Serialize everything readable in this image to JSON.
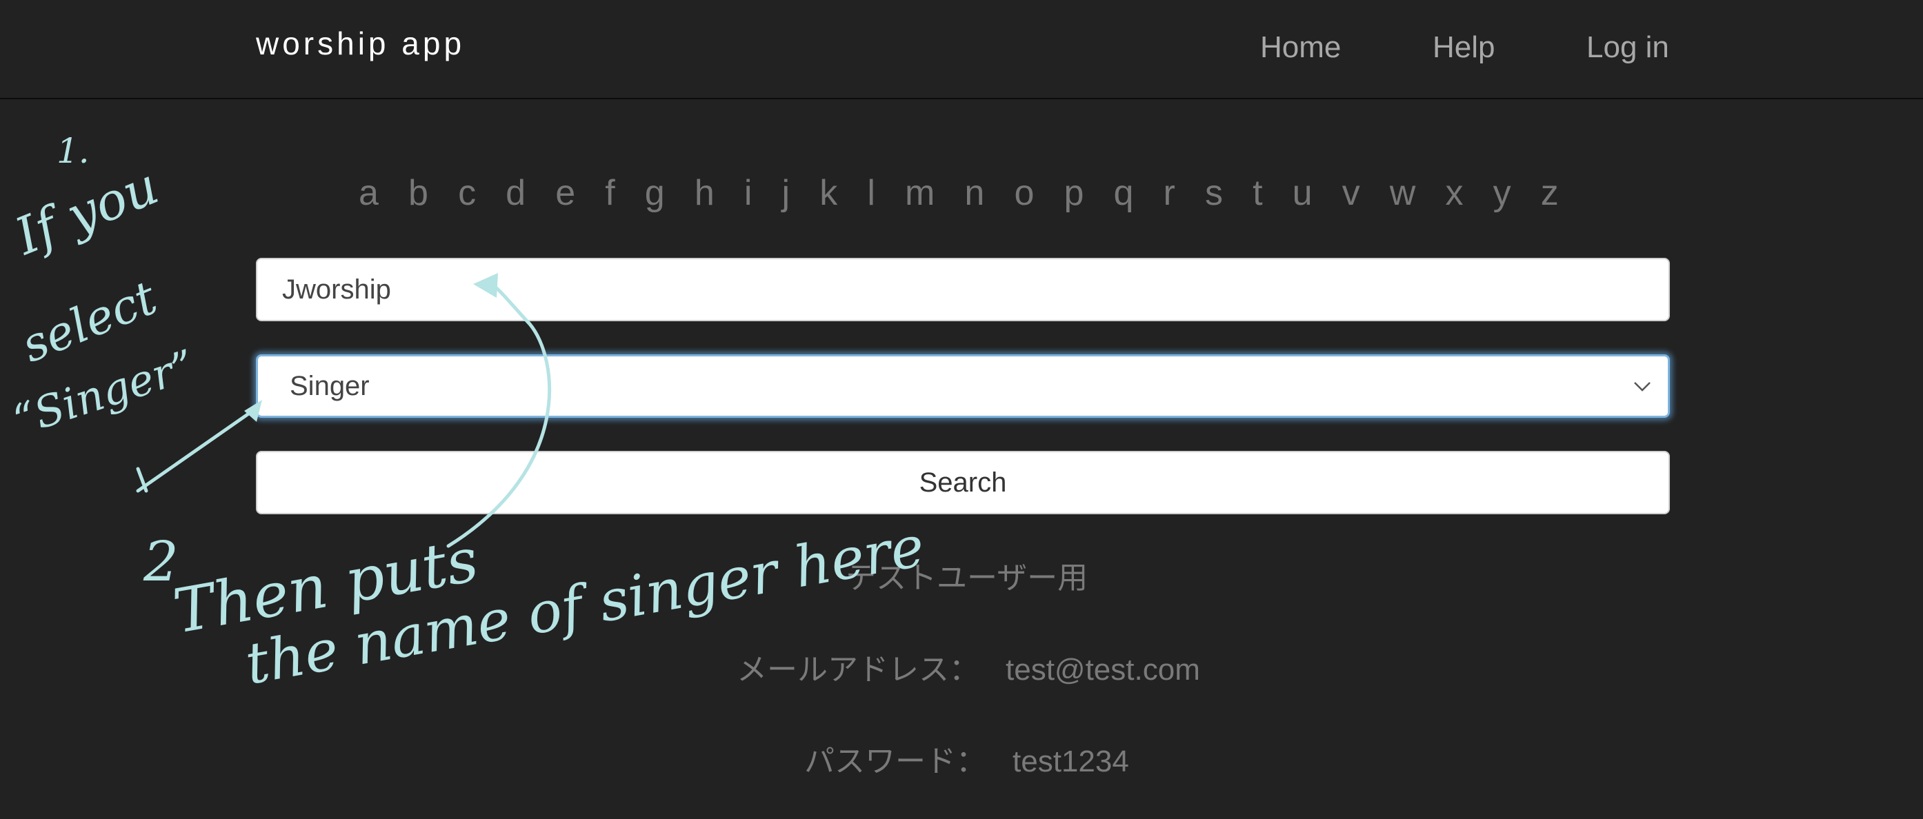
{
  "navbar": {
    "brand": "worship app",
    "links": {
      "home": "Home",
      "help": "Help",
      "login": "Log in"
    }
  },
  "alphabet": [
    "a",
    "b",
    "c",
    "d",
    "e",
    "f",
    "g",
    "h",
    "i",
    "j",
    "k",
    "l",
    "m",
    "n",
    "o",
    "p",
    "q",
    "r",
    "s",
    "t",
    "u",
    "v",
    "w",
    "x",
    "y",
    "z"
  ],
  "search": {
    "keyword_value": "Jworship",
    "category_selected": "Singer",
    "button_label": "Search"
  },
  "test_user": {
    "heading": "テストユーザー用",
    "email_label": "メールアドレス：",
    "email_value": "test@test.com",
    "password_label": "パスワード：",
    "password_value": "test1234"
  },
  "annotations": {
    "step1_number": "1.",
    "step1_lines": [
      "If you",
      "select",
      "“Singer”"
    ],
    "step2_number": "2",
    "step2_lines": [
      "Then puts",
      "the name of singer here"
    ],
    "ink_color": "#b6e3e3"
  }
}
